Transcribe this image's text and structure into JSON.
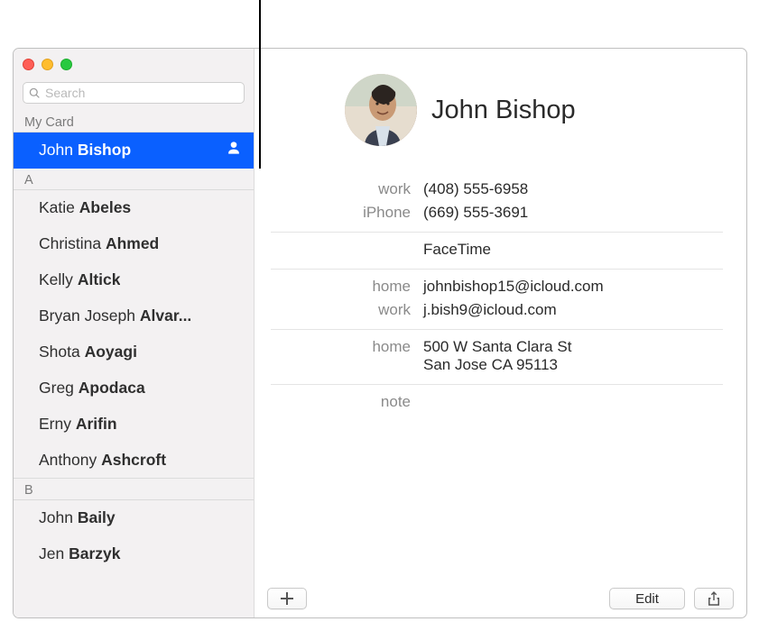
{
  "search": {
    "placeholder": "Search"
  },
  "sidebar": {
    "my_card_header": "My Card",
    "me": {
      "first": "John",
      "last": "Bishop"
    },
    "sections": [
      {
        "letter": "A",
        "rows": [
          {
            "first": "Katie",
            "last": "Abeles"
          },
          {
            "first": "Christina",
            "last": "Ahmed"
          },
          {
            "first": "Kelly",
            "last": "Altick"
          },
          {
            "first": "Bryan Joseph",
            "last": "Alvar..."
          },
          {
            "first": "Shota",
            "last": "Aoyagi"
          },
          {
            "first": "Greg",
            "last": "Apodaca"
          },
          {
            "first": "Erny",
            "last": "Arifin"
          },
          {
            "first": "Anthony",
            "last": "Ashcroft"
          }
        ]
      },
      {
        "letter": "B",
        "rows": [
          {
            "first": "John",
            "last": "Baily"
          },
          {
            "first": "Jen",
            "last": "Barzyk"
          }
        ]
      }
    ]
  },
  "card": {
    "name": "John Bishop",
    "phones": [
      {
        "label": "work",
        "value": "(408) 555-6958"
      },
      {
        "label": "iPhone",
        "value": "(669) 555-3691"
      }
    ],
    "facetime_label": "FaceTime",
    "emails": [
      {
        "label": "home",
        "value": "johnbishop15@icloud.com"
      },
      {
        "label": "work",
        "value": "j.bish9@icloud.com"
      }
    ],
    "address": {
      "label": "home",
      "line1": "500 W Santa Clara St",
      "line2": "San Jose CA 95113"
    },
    "note_label": "note"
  },
  "buttons": {
    "edit": "Edit"
  }
}
